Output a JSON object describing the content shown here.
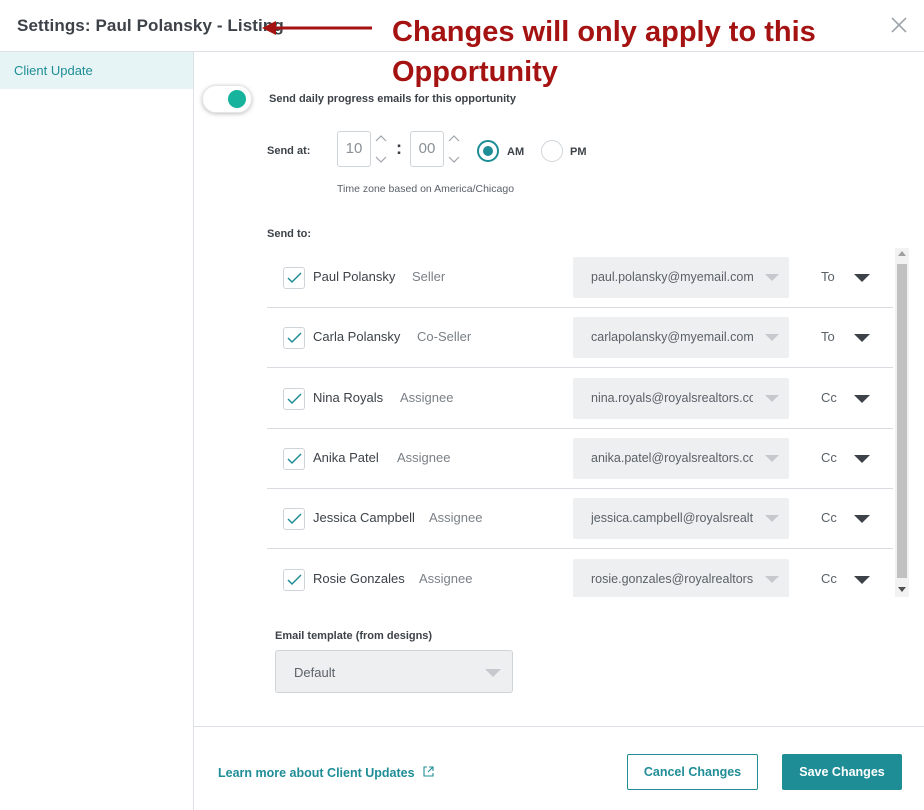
{
  "header": {
    "title": "Settings: Paul Polansky - Listing",
    "annotation": "Changes will only apply to this Opportunity"
  },
  "sidebar": {
    "items": [
      {
        "label": "Client Update",
        "active": true
      }
    ]
  },
  "settings": {
    "toggle_label": "Send daily progress emails for this opportunity",
    "toggle_on": true,
    "send_at_label": "Send at:",
    "hour": "10",
    "minute": "00",
    "colon": ":",
    "am_label": "AM",
    "pm_label": "PM",
    "period_selected": "AM",
    "timezone_note": "Time zone based on America/Chicago",
    "send_to_label": "Send to:"
  },
  "recipients": [
    {
      "name": "Paul Polansky",
      "role": "Seller",
      "email": "paul.polansky@myemail.com",
      "type": "To",
      "checked": true
    },
    {
      "name": "Carla Polansky",
      "role": "Co-Seller",
      "email": "carlapolansky@myemail.com",
      "type": "To",
      "checked": true
    },
    {
      "name": "Nina Royals",
      "role": "Assignee",
      "email": "nina.royals@royalsrealtors.com",
      "type": "Cc",
      "checked": true
    },
    {
      "name": "Anika Patel",
      "role": "Assignee",
      "email": "anika.patel@royalsrealtors.com",
      "type": "Cc",
      "checked": true
    },
    {
      "name": "Jessica Campbell",
      "role": "Assignee",
      "email": "jessica.campbell@royalsrealtors.com",
      "type": "Cc",
      "checked": true
    },
    {
      "name": "Rosie Gonzales",
      "role": "Assignee",
      "email": "rosie.gonzales@royalrealtors.com",
      "type": "Cc",
      "checked": true
    }
  ],
  "template": {
    "label": "Email template (from designs)",
    "value": "Default"
  },
  "footer": {
    "learn_more": "Learn more about Client Updates",
    "cancel_label": "Cancel Changes",
    "save_label": "Save Changes"
  },
  "colors": {
    "accent": "#1f8d96",
    "toggle_on": "#17b39c",
    "annotation": "#a51212"
  }
}
